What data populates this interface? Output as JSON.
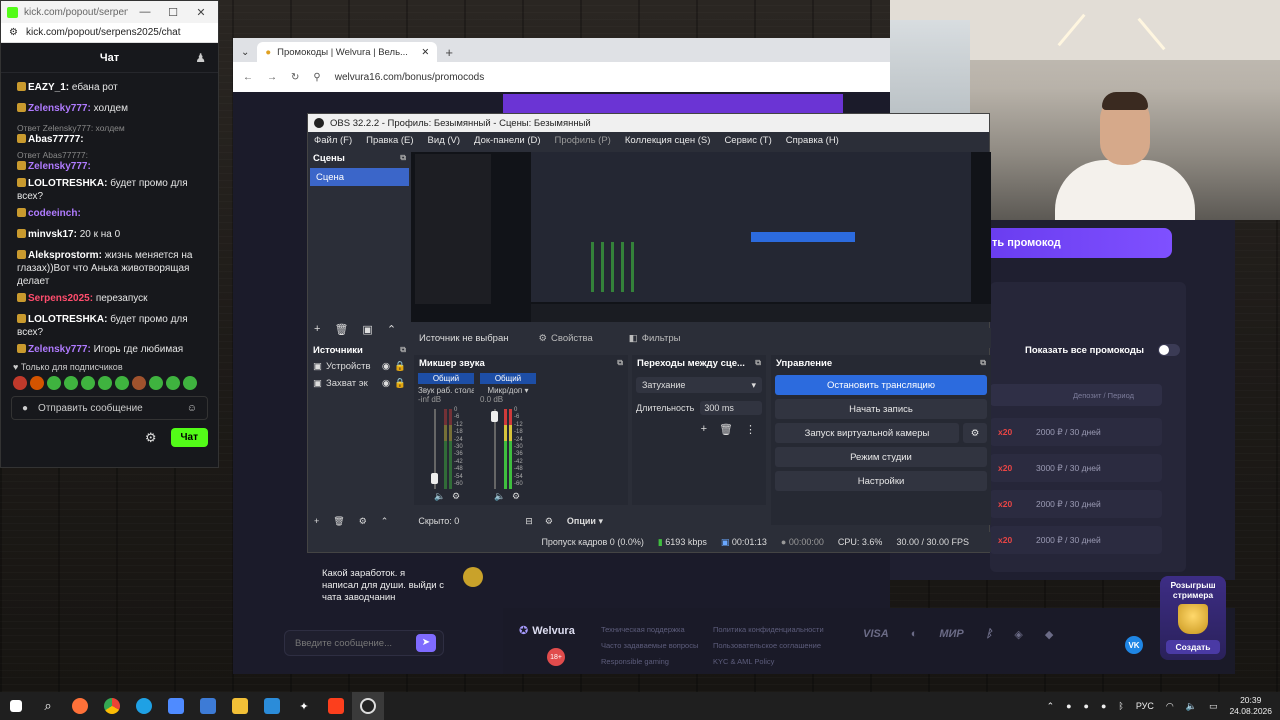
{
  "kick": {
    "window_title": "kick.com/popout/serpens20...",
    "url": "kick.com/popout/serpens2025/chat",
    "chat_title": "Чат",
    "messages": [
      {
        "reply": "",
        "user": "EAZY_1:",
        "user_color": "#ffffff",
        "text": "ебана рот"
      },
      {
        "reply": "",
        "user": "Zelensky777:",
        "user_color": "#b07bff",
        "text": "холдем"
      },
      {
        "reply": "Ответ Zelensky777: холдем",
        "user": "Abas77777:",
        "user_color": "#ffffff",
        "text": ""
      },
      {
        "reply": "Ответ Abas77777:",
        "user": "Zelensky777:",
        "user_color": "#b07bff",
        "text": ""
      },
      {
        "reply": "",
        "user": "LOLOTRESHKA:",
        "user_color": "#ffffff",
        "text": "будет промо для всех?"
      },
      {
        "reply": "",
        "user": "codeeinch:",
        "user_color": "#b07bff",
        "text": ""
      },
      {
        "reply": "",
        "user": "minvsk17:",
        "user_color": "#ffffff",
        "text": "20 к на 0"
      },
      {
        "reply": "",
        "user": "Aleksprostorm:",
        "user_color": "#ffffff",
        "text": "жизнь меняется на глазах))Вот что Анька животворящая делает"
      },
      {
        "reply": "",
        "user": "Serpens2025:",
        "user_color": "#ff4d6d",
        "text": "перезапуск"
      },
      {
        "reply": "",
        "user": "LOLOTRESHKA:",
        "user_color": "#ffffff",
        "text": "будет промо для всех?"
      },
      {
        "reply": "",
        "user": "Zelensky777:",
        "user_color": "#b07bff",
        "text": "Игорь где любимая"
      }
    ],
    "subs_only": "Только для подписчиков",
    "input_placeholder": "Отправить сообщение",
    "send_label": "Чат"
  },
  "browser": {
    "tab_title": "Промокоды | Welvura | Вель...",
    "url": "welvura16.com/bonus/promocods",
    "promo_button": "ть промокод",
    "show_all": "Показать все промокоды",
    "table_header": "Депозит / Период",
    "promo_rows": [
      {
        "mult": "x20",
        "text": "2000 ₽ / 30 дней"
      },
      {
        "mult": "x20",
        "text": "3000 ₽ / 30 дней"
      },
      {
        "mult": "x20",
        "text": "2000 ₽ / 30 дней"
      },
      {
        "mult": "x20",
        "text": "2000 ₽ / 30 дней"
      }
    ],
    "site_chat_text": "Какой заработок. я написал для души. выйди с чата заводчанин",
    "site_chat_input": "Введите сообщение...",
    "giveaway_title": "Розыгрыш стримера",
    "giveaway_button": "Создать",
    "footer": {
      "brand": "Welvura",
      "col1": [
        "Техническая поддержка",
        "Часто задаваемые вопросы",
        "Responsible gaming"
      ],
      "col2": [
        "Политика конфиденциальности",
        "Пользовательское соглашение",
        "KYC & AML Policy"
      ],
      "age": "18+",
      "pay": [
        "VISA",
        "МИР"
      ],
      "social": "VK"
    }
  },
  "obs": {
    "title": "OBS 32.2.2 - Профиль: Безымянный - Сцены: Безымянный",
    "menu": [
      "Файл (F)",
      "Правка (E)",
      "Вид (V)",
      "Док-панели (D)",
      "Профиль (P)",
      "Коллекция сцен (S)",
      "Сервис (T)",
      "Справка (H)"
    ],
    "scenes_title": "Сцены",
    "scene_item": "Сцена",
    "sources_title": "Источники",
    "sources": [
      "Устройств",
      "Захват эк"
    ],
    "source_none": "Источник не выбран",
    "properties": "Свойства",
    "filters": "Фильтры",
    "mixer_title": "Микшер звука",
    "mixer_channels": [
      {
        "tag": "Общий",
        "name": "Звук раб. стола",
        "db": "-inf dB"
      },
      {
        "tag": "Общий",
        "name": "Микр/доп",
        "db": "0.0 dB"
      }
    ],
    "mixer_scale": [
      "0",
      "-6",
      "-12",
      "-18",
      "-24",
      "-30",
      "-36",
      "-42",
      "-48",
      "-54",
      "-60"
    ],
    "transitions_title": "Переходы между сце...",
    "transition_type": "Затухание",
    "duration_label": "Длительность",
    "duration_value": "300 ms",
    "controls_title": "Управление",
    "controls": [
      "Остановить трансляцию",
      "Начать запись",
      "Запуск виртуальной камеры",
      "Режим студии",
      "Настройки"
    ],
    "hidden": "Скрыто: 0",
    "options": "Опции",
    "status": {
      "dropped": "Пропуск кадров 0 (0.0%)",
      "bitrate": "6193 kbps",
      "stream_time": "00:01:13",
      "rec_time": "00:00:00",
      "cpu": "CPU: 3.6%",
      "fps": "30.00 / 30.00 FPS"
    }
  },
  "taskbar": {
    "lang": "РУС",
    "time": "20:39",
    "date": "24.08.2026"
  },
  "colors": {
    "obs_accent": "#2c6bde",
    "kick_green": "#53fc18",
    "welvura_purple": "#6a3df0",
    "promo_red": "#e84545"
  }
}
